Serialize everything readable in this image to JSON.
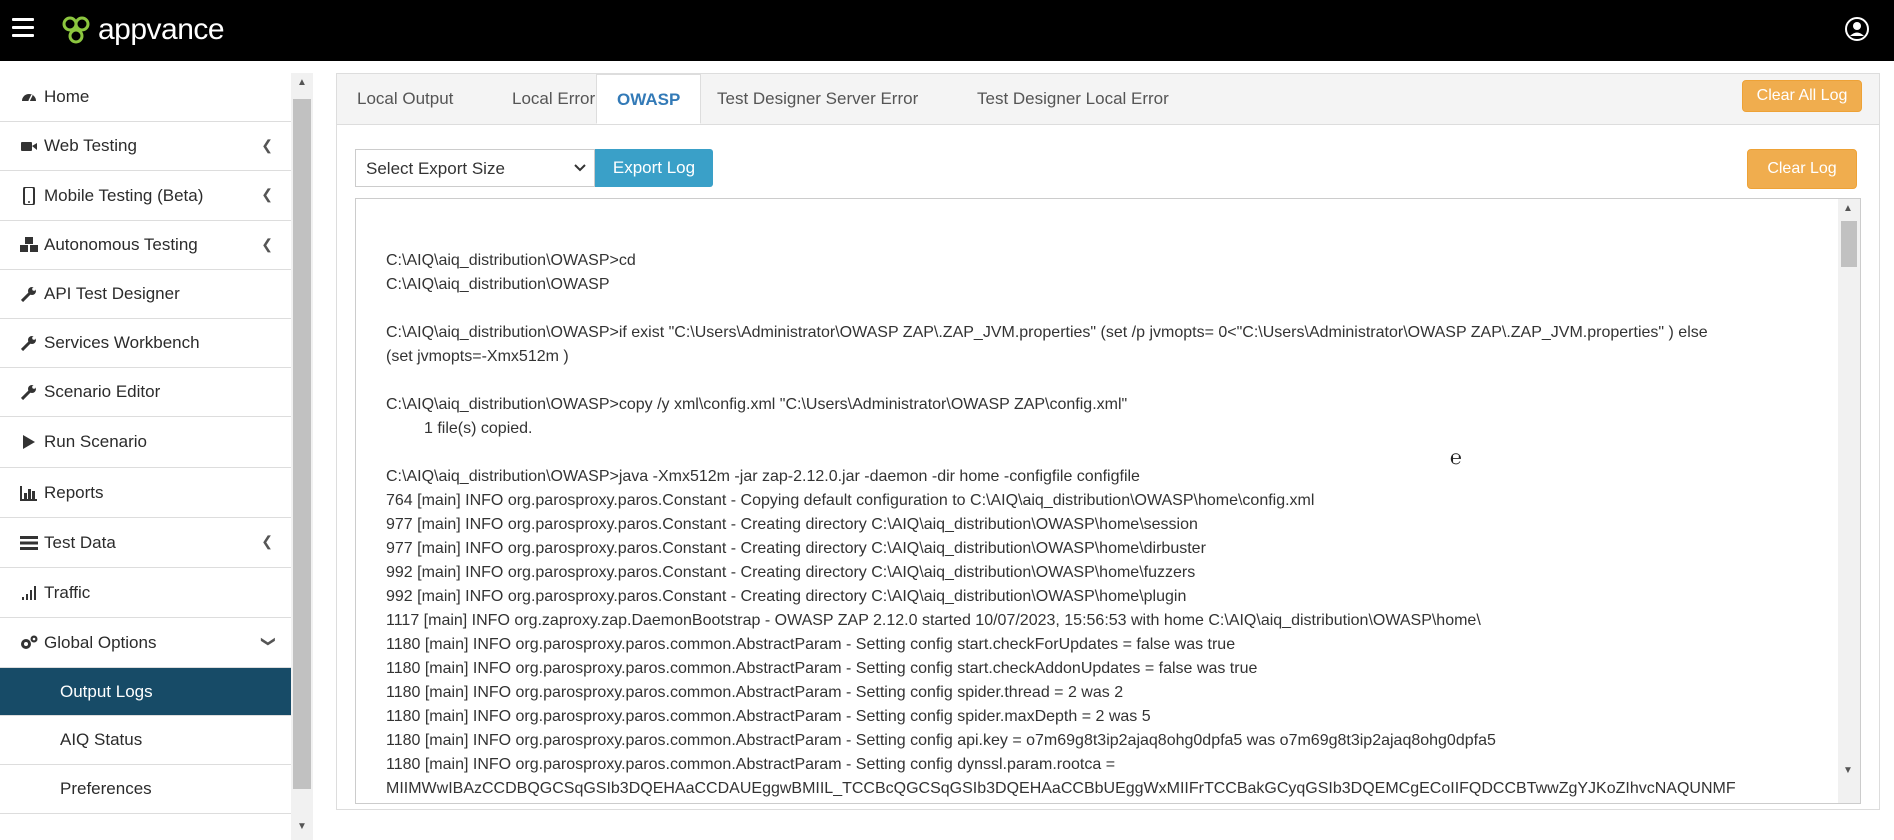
{
  "header": {
    "logo_text": "appvance",
    "menu_icon": "hamburger-icon",
    "user_icon": "user-icon"
  },
  "sidebar": {
    "items": [
      {
        "label": "Home",
        "icon": "dashboard-icon",
        "has_chevron": false
      },
      {
        "label": "Web Testing",
        "icon": "video-camera-icon",
        "has_chevron": true
      },
      {
        "label": "Mobile Testing (Beta)",
        "icon": "mobile-icon",
        "has_chevron": true
      },
      {
        "label": "Autonomous Testing",
        "icon": "cubes-icon",
        "has_chevron": true
      },
      {
        "label": "API Test Designer",
        "icon": "wrench-icon",
        "has_chevron": false
      },
      {
        "label": "Services Workbench",
        "icon": "wrench-icon",
        "has_chevron": false
      },
      {
        "label": "Scenario Editor",
        "icon": "wrench-icon",
        "has_chevron": false
      },
      {
        "label": "Run Scenario",
        "icon": "play-icon",
        "has_chevron": false
      },
      {
        "label": "Reports",
        "icon": "bar-chart-icon",
        "has_chevron": false
      },
      {
        "label": "Test Data",
        "icon": "tasks-icon",
        "has_chevron": true
      },
      {
        "label": "Traffic",
        "icon": "signal-icon",
        "has_chevron": false
      },
      {
        "label": "Global Options",
        "icon": "cogs-icon",
        "has_chevron": true
      }
    ],
    "sub_items": [
      {
        "label": "Output Logs",
        "active": true
      },
      {
        "label": "AIQ Status",
        "active": false
      },
      {
        "label": "Preferences",
        "active": false
      }
    ]
  },
  "tabs": [
    {
      "label": "Local Output",
      "active": false
    },
    {
      "label": "Local Error",
      "active": false
    },
    {
      "label": "OWASP",
      "active": true
    },
    {
      "label": "Test Designer Server Error",
      "active": false
    },
    {
      "label": "Test Designer Local Error",
      "active": false
    }
  ],
  "actions": {
    "clear_all_log": "Clear All Log",
    "clear_log": "Clear Log",
    "export_select": "Select Export Size",
    "export_log": "Export Log"
  },
  "log_lines": [
    "C:\\AIQ\\aiq_distribution\\OWASP>cd",
    "C:\\AIQ\\aiq_distribution\\OWASP",
    "",
    "C:\\AIQ\\aiq_distribution\\OWASP>if exist \"C:\\Users\\Administrator\\OWASP ZAP\\.ZAP_JVM.properties\" (set /p jvmopts= 0<\"C:\\Users\\Administrator\\OWASP ZAP\\.ZAP_JVM.properties\" )  else",
    "(set jvmopts=-Xmx512m )",
    "",
    "C:\\AIQ\\aiq_distribution\\OWASP>copy /y xml\\config.xml \"C:\\Users\\Administrator\\OWASP ZAP\\config.xml\"",
    "1 file(s) copied.",
    "",
    "C:\\AIQ\\aiq_distribution\\OWASP>java -Xmx512m -jar zap-2.12.0.jar -daemon -dir home -configfile configfile",
    "764 [main] INFO  org.parosproxy.paros.Constant - Copying default configuration to C:\\AIQ\\aiq_distribution\\OWASP\\home\\config.xml",
    "977 [main] INFO  org.parosproxy.paros.Constant - Creating directory C:\\AIQ\\aiq_distribution\\OWASP\\home\\session",
    "977 [main] INFO  org.parosproxy.paros.Constant - Creating directory C:\\AIQ\\aiq_distribution\\OWASP\\home\\dirbuster",
    "992 [main] INFO  org.parosproxy.paros.Constant - Creating directory C:\\AIQ\\aiq_distribution\\OWASP\\home\\fuzzers",
    "992 [main] INFO  org.parosproxy.paros.Constant - Creating directory C:\\AIQ\\aiq_distribution\\OWASP\\home\\plugin",
    "1117 [main] INFO  org.zaproxy.zap.DaemonBootstrap - OWASP ZAP 2.12.0 started 10/07/2023, 15:56:53 with home C:\\AIQ\\aiq_distribution\\OWASP\\home\\",
    "1180 [main] INFO  org.parosproxy.paros.common.AbstractParam - Setting config start.checkForUpdates = false was true",
    "1180 [main] INFO  org.parosproxy.paros.common.AbstractParam - Setting config start.checkAddonUpdates = false was true",
    "1180 [main] INFO  org.parosproxy.paros.common.AbstractParam - Setting config spider.thread = 2 was 2",
    "1180 [main] INFO  org.parosproxy.paros.common.AbstractParam - Setting config spider.maxDepth = 2 was 5",
    "1180 [main] INFO  org.parosproxy.paros.common.AbstractParam - Setting config api.key = o7m69g8t3ip2ajaq8ohg0dpfa5 was o7m69g8t3ip2ajaq8ohg0dpfa5",
    "1180 [main] INFO  org.parosproxy.paros.common.AbstractParam - Setting config dynssl.param.rootca =",
    "MIIMWwIBAzCCDBQGCSqGSIb3DQEHAaCCDAUEggwBMIIL_TCCBcQGCSqGSIb3DQEHAaCCBbUEggWxMIIFrTCCBakGCyqGSIb3DQEMCgECoIIFQDCCBTwwZgYJKoZIhvcNAQUNMF"
  ]
}
